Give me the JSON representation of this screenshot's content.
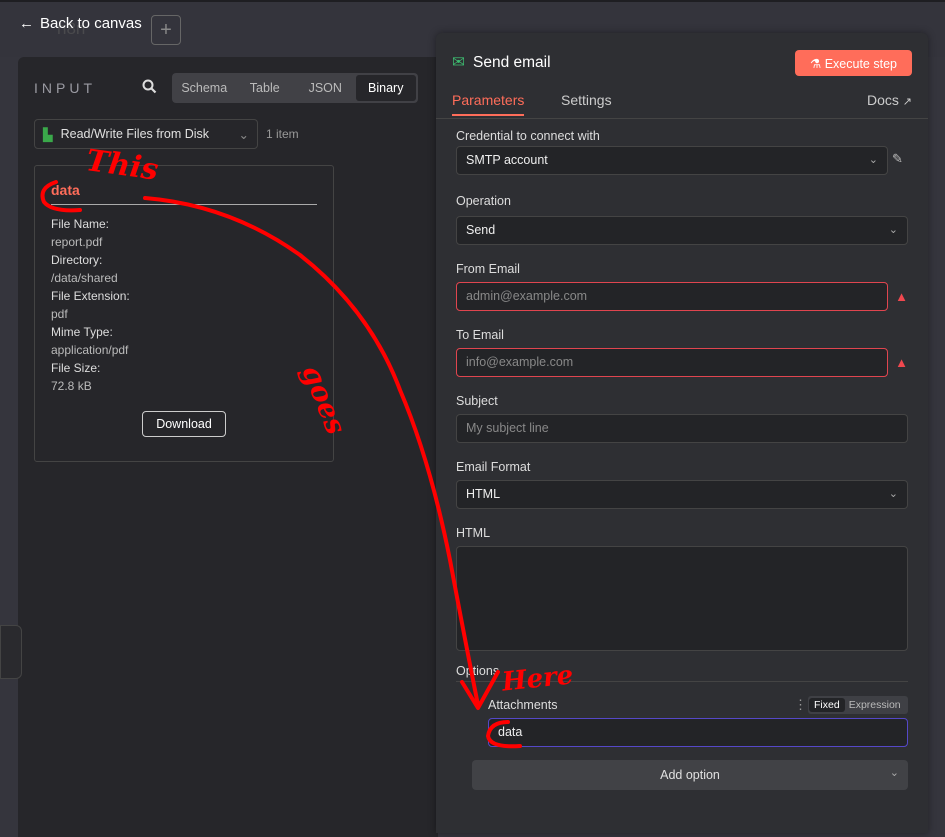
{
  "header": {
    "back_label": "Back to canvas",
    "logo_text": "n8n"
  },
  "input": {
    "title": "INPUT",
    "tabs": [
      "Schema",
      "Table",
      "JSON",
      "Binary"
    ],
    "active_tab": "Binary",
    "node": "Read/Write Files from Disk",
    "item_count": "1 item",
    "binary": {
      "key": "data",
      "fields": [
        {
          "label": "File Name:",
          "value": "report.pdf"
        },
        {
          "label": "Directory:",
          "value": "/data/shared"
        },
        {
          "label": "File Extension:",
          "value": "pdf"
        },
        {
          "label": "Mime Type:",
          "value": "application/pdf"
        },
        {
          "label": "File Size:",
          "value": "72.8 kB"
        }
      ],
      "download_label": "Download"
    }
  },
  "node": {
    "title": "Send email",
    "execute_label": "Execute step",
    "tabs": [
      "Parameters",
      "Settings"
    ],
    "docs_label": "Docs",
    "credential_label": "Credential to connect with",
    "credential_value": "SMTP account",
    "operation_label": "Operation",
    "operation_value": "Send",
    "from_label": "From Email",
    "from_placeholder": "admin@example.com",
    "to_label": "To Email",
    "to_placeholder": "info@example.com",
    "subject_label": "Subject",
    "subject_placeholder": "My subject line",
    "format_label": "Email Format",
    "format_value": "HTML",
    "html_label": "HTML",
    "options_label": "Options",
    "attachments_label": "Attachments",
    "mode_fixed": "Fixed",
    "mode_expression": "Expression",
    "attachments_value": "data",
    "add_option_label": "Add option"
  },
  "annotation": {
    "words": [
      "This",
      "goes",
      "Here"
    ],
    "color": "#ff0000"
  },
  "colors": {
    "accent": "#ff6d5a",
    "error": "#e0454f"
  }
}
